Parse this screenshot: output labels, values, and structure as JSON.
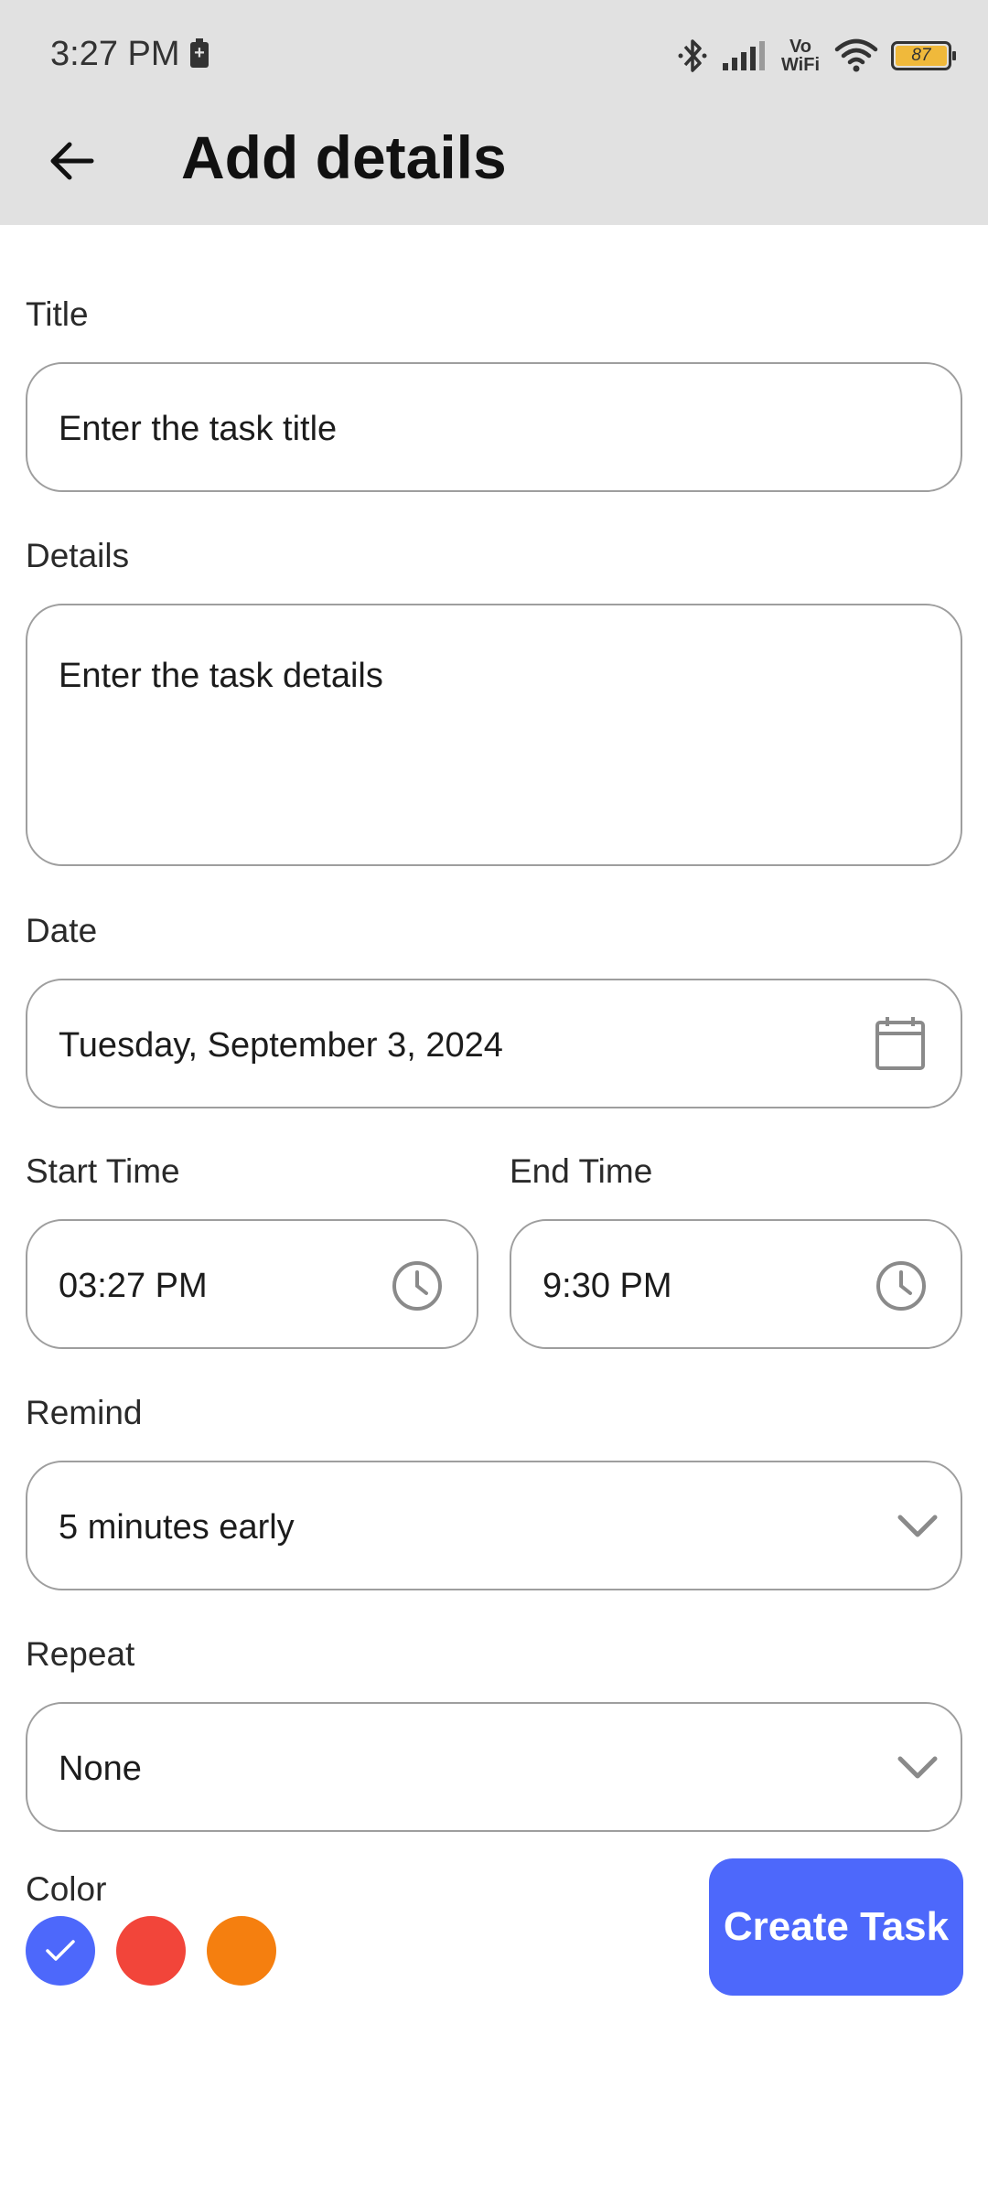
{
  "status_bar": {
    "time": "3:27 PM",
    "vowifi": "Vo WiFi",
    "battery_level": "87",
    "icons": [
      "battery-saver-icon",
      "bluetooth-icon",
      "signal-icon",
      "vowifi-icon",
      "wifi-icon",
      "battery-icon"
    ]
  },
  "appbar": {
    "title": "Add details",
    "back_icon": "arrow-back-icon"
  },
  "form": {
    "title": {
      "label": "Title",
      "placeholder": "Enter the task title"
    },
    "details": {
      "label": "Details",
      "placeholder": "Enter the task details"
    },
    "date": {
      "label": "Date",
      "value": "Tuesday, September 3, 2024",
      "icon": "calendar-icon"
    },
    "start_time": {
      "label": "Start Time",
      "value": "03:27 PM",
      "icon": "clock-icon"
    },
    "end_time": {
      "label": "End Time",
      "value": "9:30 PM",
      "icon": "clock-icon"
    },
    "remind": {
      "label": "Remind",
      "value": "5 minutes early",
      "icon": "chevron-down-icon"
    },
    "repeat": {
      "label": "Repeat",
      "value": "None",
      "icon": "chevron-down-icon"
    },
    "color": {
      "label": "Color",
      "options": [
        {
          "name": "blue",
          "hex": "#4d68fb",
          "selected": true
        },
        {
          "name": "red",
          "hex": "#f2453a",
          "selected": false
        },
        {
          "name": "orange",
          "hex": "#f57f0f",
          "selected": false
        }
      ]
    },
    "submit_label": "Create Task"
  },
  "colors": {
    "appbar_bg": "#e1e1e1",
    "accent": "#4d68fb",
    "field_border": "#9e9e9e"
  }
}
